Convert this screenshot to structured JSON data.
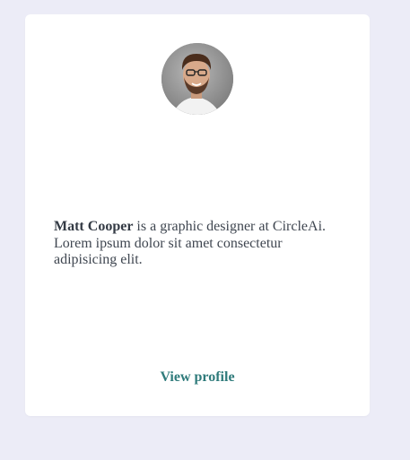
{
  "card": {
    "avatar_alt": "Matt Cooper",
    "bio": {
      "name": "Matt Cooper",
      "text_line": " is a graphic designer at CircleAi. Lorem ipsum dolor sit amet consectetur adipisicing elit."
    },
    "profile_link_label": "View profile"
  },
  "colors": {
    "page_background": "#ececf7",
    "card_background": "#ffffff",
    "link": "#2f7b7b",
    "body_text": "#3f4650"
  }
}
